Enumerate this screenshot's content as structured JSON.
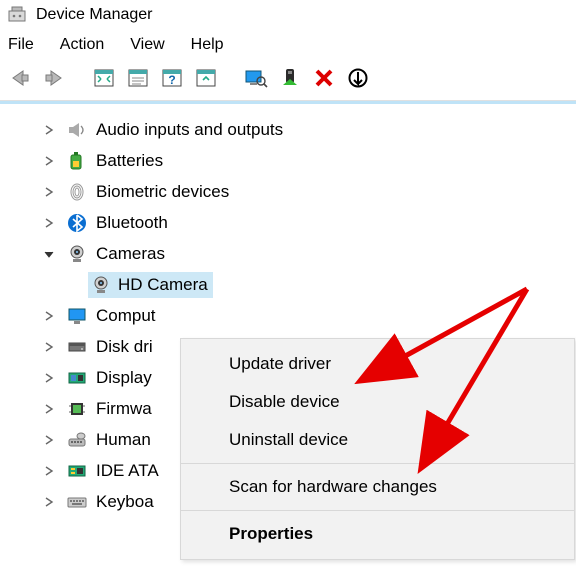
{
  "window": {
    "title": "Device Manager"
  },
  "menubar": [
    "File",
    "Action",
    "View",
    "Help"
  ],
  "tree": {
    "items": [
      {
        "label": "Audio inputs and outputs",
        "icon": "speaker",
        "expanded": false
      },
      {
        "label": "Batteries",
        "icon": "battery",
        "expanded": false
      },
      {
        "label": "Biometric devices",
        "icon": "fingerprint",
        "expanded": false
      },
      {
        "label": "Bluetooth",
        "icon": "bluetooth",
        "expanded": false
      },
      {
        "label": "Cameras",
        "icon": "camera",
        "expanded": true,
        "children": [
          {
            "label": "HD Camera",
            "icon": "camera",
            "selected": true
          }
        ]
      },
      {
        "label": "Comput",
        "icon": "monitor",
        "expanded": false
      },
      {
        "label": "Disk dri",
        "icon": "disk",
        "expanded": false
      },
      {
        "label": "Display",
        "icon": "gpu",
        "expanded": false
      },
      {
        "label": "Firmwa",
        "icon": "chip",
        "expanded": false
      },
      {
        "label": "Human",
        "icon": "hid",
        "expanded": false
      },
      {
        "label": "IDE ATA",
        "icon": "ide",
        "expanded": false
      },
      {
        "label": "Keyboa",
        "icon": "keyboard",
        "expanded": false
      }
    ]
  },
  "context_menu": {
    "items": [
      {
        "label": "Update driver"
      },
      {
        "label": "Disable device"
      },
      {
        "label": "Uninstall device"
      },
      {
        "sep": true
      },
      {
        "label": "Scan for hardware changes"
      },
      {
        "sep": true
      },
      {
        "label": "Properties",
        "bold": true
      }
    ]
  }
}
